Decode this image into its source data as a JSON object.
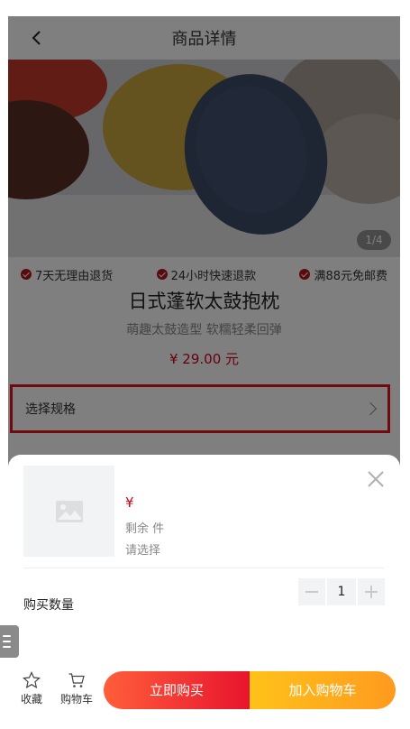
{
  "nav": {
    "title": "商品详情",
    "back_icon": "chevron-left-icon"
  },
  "gallery": {
    "pager": "1/4"
  },
  "guarantees": [
    {
      "label": "7天无理由退货"
    },
    {
      "label": "24小时快速退款"
    },
    {
      "label": "满88元免邮费"
    }
  ],
  "product": {
    "name": "日式蓬软太鼓抱枕",
    "subtitle": "萌趣太鼓造型 软糯轻柔回弹",
    "price": "¥ 29.00 元"
  },
  "spec": {
    "label": "选择规格"
  },
  "sheet": {
    "price": "¥",
    "stock": "剩余 件",
    "select_hint": "请选择",
    "qty_label": "购买数量",
    "qty_value": "1"
  },
  "actions": {
    "favorite": "收藏",
    "cart": "购物车",
    "buy_now": "立即购买",
    "add_cart": "加入购物车"
  },
  "colors": {
    "accent": "#d0021b",
    "highlight_border": "#e0141e",
    "buy_gradient_end": "#e8142e",
    "cart_gradient_end": "#ff9a1f"
  }
}
